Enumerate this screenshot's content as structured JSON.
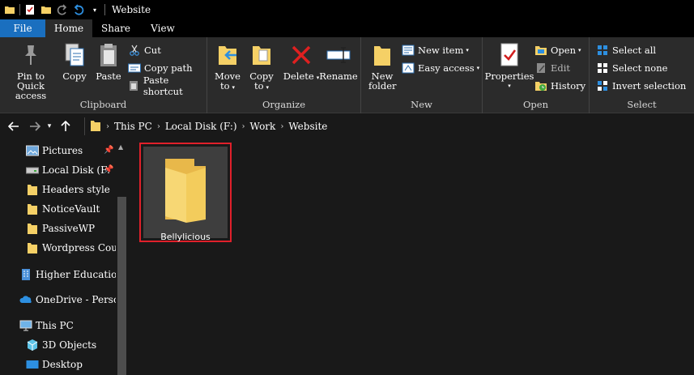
{
  "window": {
    "title": "Website"
  },
  "ribbon_tabs": [
    "File",
    "Home",
    "Share",
    "View"
  ],
  "ribbon": {
    "clipboard": {
      "label": "Clipboard",
      "pin": "Pin to Quick access",
      "copy": "Copy",
      "paste": "Paste",
      "cut": "Cut",
      "copy_path": "Copy path",
      "paste_shortcut": "Paste shortcut"
    },
    "organize": {
      "label": "Organize",
      "move_to": "Move to",
      "copy_to": "Copy to",
      "delete": "Delete",
      "rename": "Rename"
    },
    "new": {
      "label": "New",
      "new_folder": "New folder",
      "new_item": "New item",
      "easy_access": "Easy access"
    },
    "open": {
      "label": "Open",
      "properties": "Properties",
      "open": "Open",
      "edit": "Edit",
      "history": "History"
    },
    "select": {
      "label": "Select",
      "select_all": "Select all",
      "select_none": "Select none",
      "invert_selection": "Invert selection"
    }
  },
  "breadcrumb": [
    "This PC",
    "Local Disk (F:)",
    "Work",
    "Website"
  ],
  "nav_pane": {
    "items": [
      {
        "label": "Pictures",
        "icon": "pictures-icon",
        "pinned": true
      },
      {
        "label": "Local Disk (F:",
        "icon": "drive-icon",
        "pinned": true
      },
      {
        "label": "Headers style",
        "icon": "folder-icon"
      },
      {
        "label": "NoticeVault",
        "icon": "folder-icon"
      },
      {
        "label": "PassiveWP",
        "icon": "folder-icon"
      },
      {
        "label": "Wordpress Cou",
        "icon": "folder-icon"
      },
      {
        "label": "Higher Education",
        "icon": "building-icon"
      },
      {
        "label": "OneDrive - Perso",
        "icon": "onedrive-icon"
      },
      {
        "label": "This PC",
        "icon": "computer-icon"
      },
      {
        "label": "3D Objects",
        "icon": "cube-icon"
      },
      {
        "label": "Desktop",
        "icon": "desktop-icon"
      }
    ]
  },
  "content": {
    "folders": [
      {
        "name": "Bellylicious",
        "selected": true
      }
    ]
  },
  "colors": {
    "accent": "#1a6fbf",
    "selection_outline": "#e0202a",
    "folder_yellow": "#f5d066",
    "background": "#191919"
  }
}
